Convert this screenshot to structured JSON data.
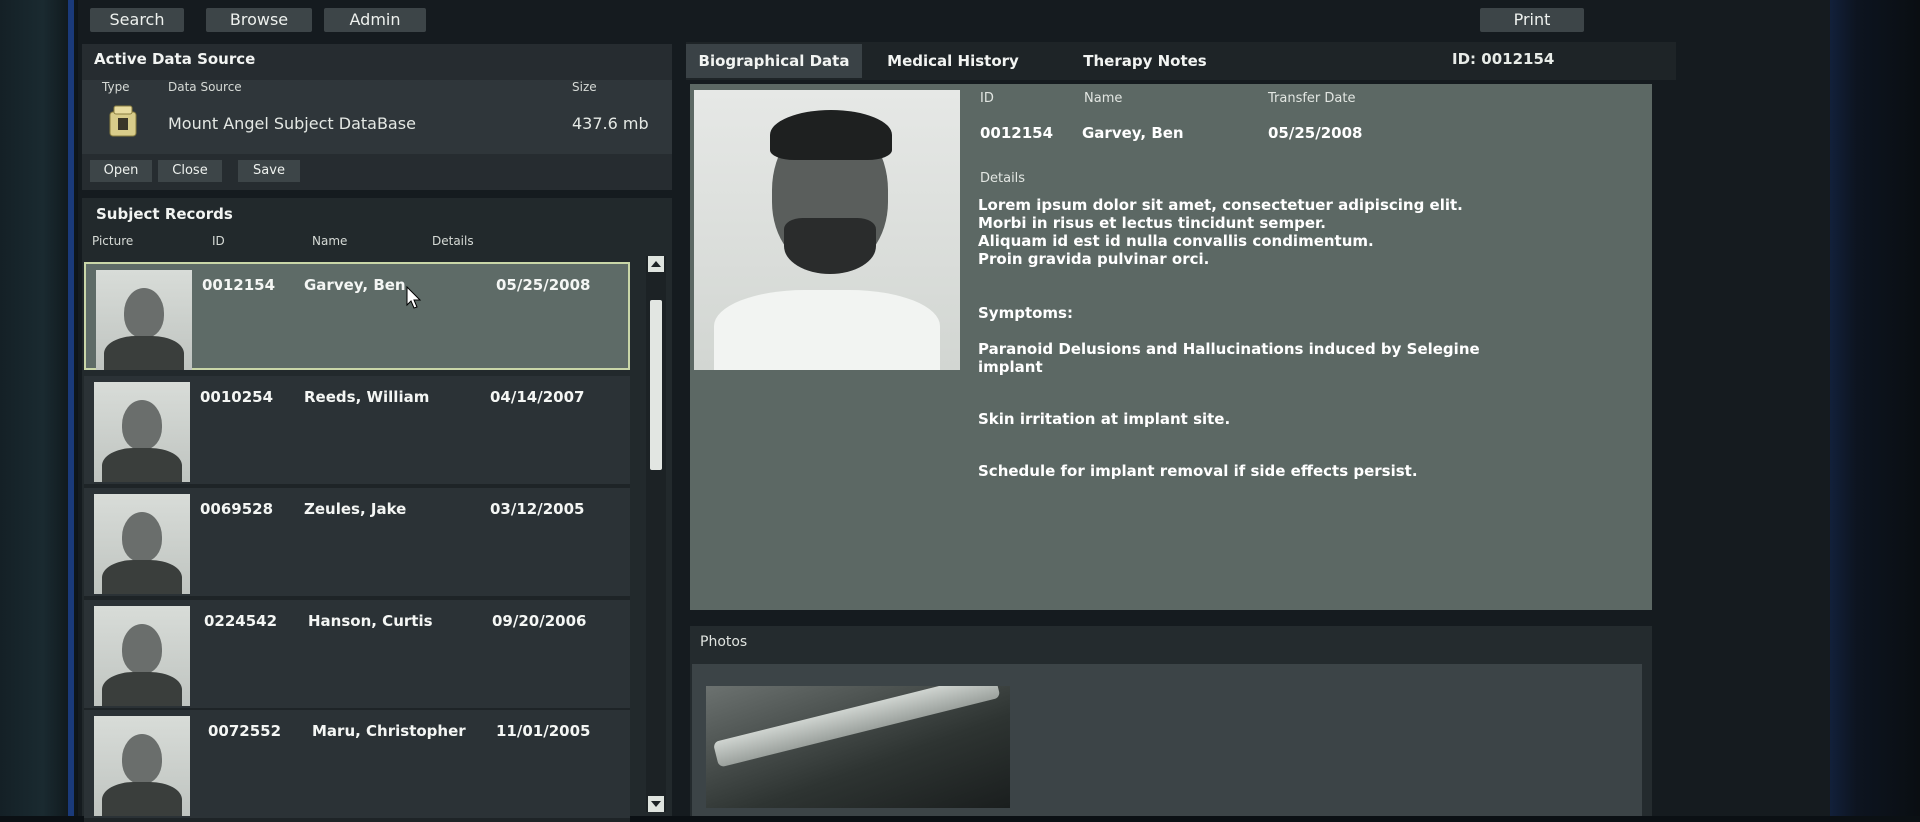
{
  "toolbar": {
    "search": "Search",
    "browse": "Browse",
    "admin": "Admin",
    "print": "Print"
  },
  "data_source": {
    "title": "Active Data Source",
    "columns": {
      "type": "Type",
      "source": "Data Source",
      "size": "Size"
    },
    "row": {
      "name": "Mount Angel Subject DataBase",
      "size": "437.6 mb",
      "icon": "database-icon"
    },
    "buttons": {
      "open": "Open",
      "close": "Close",
      "save": "Save"
    }
  },
  "records": {
    "title": "Subject Records",
    "columns": {
      "picture": "Picture",
      "id": "ID",
      "name": "Name",
      "details": "Details"
    },
    "rows": [
      {
        "id": "0012154",
        "name": "Garvey, Ben",
        "date": "05/25/2008"
      },
      {
        "id": "0010254",
        "name": "Reeds, William",
        "date": "04/14/2007"
      },
      {
        "id": "0069528",
        "name": "Zeules, Jake",
        "date": "03/12/2005"
      },
      {
        "id": "0224542",
        "name": "Hanson, Curtis",
        "date": "09/20/2006"
      },
      {
        "id": "0072552",
        "name": "Maru, Christopher",
        "date": "11/01/2005"
      }
    ]
  },
  "detail": {
    "tabs": {
      "bio": "Biographical Data",
      "medical": "Medical History",
      "therapy": "Therapy Notes"
    },
    "id_label": "ID: 0012154",
    "fields": {
      "id_label": "ID",
      "name_label": "Name",
      "transfer_label": "Transfer Date",
      "id": "0012154",
      "name": "Garvey, Ben",
      "transfer": "05/25/2008",
      "details_label": "Details",
      "details_text": [
        "Lorem ipsum dolor sit amet, consectetuer adipiscing elit.",
        "Morbi in risus et lectus tincidunt semper.",
        "Aliquam id est id nulla convallis condimentum.",
        "Proin gravida pulvinar orci."
      ],
      "symptoms_label": "Symptoms:",
      "symptom1_line1": "Paranoid Delusions and Hallucinations induced by Selegine",
      "symptom1_line2": "implant",
      "symptom2": "Skin irritation at implant site.",
      "symptom3": "Schedule for implant removal if side effects persist."
    },
    "photos_title": "Photos"
  }
}
